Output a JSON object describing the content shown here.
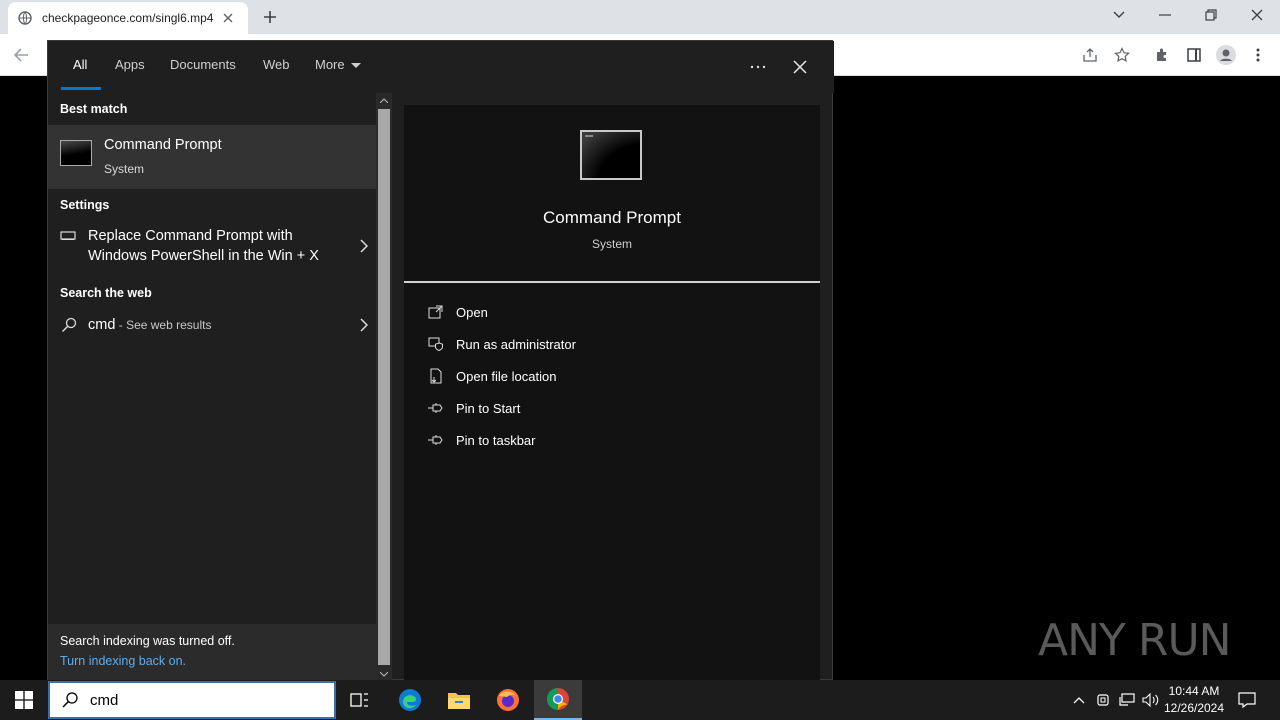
{
  "browser": {
    "tab_title": "checkpageonce.com/singl6.mp4",
    "controls": {
      "minimize": "minimize",
      "restore": "restore",
      "close": "close"
    }
  },
  "search_panel": {
    "tabs": [
      {
        "label": "All",
        "active": true
      },
      {
        "label": "Apps"
      },
      {
        "label": "Documents"
      },
      {
        "label": "Web"
      },
      {
        "label": "More"
      }
    ],
    "sections": {
      "best_match": "Best match",
      "settings": "Settings",
      "search_web": "Search the web"
    },
    "best_match_item": {
      "title": "Command Prompt",
      "subtitle": "System"
    },
    "settings_item": {
      "line1": "Replace Command Prompt with",
      "line2": "Windows PowerShell in the Win + X"
    },
    "web_item": {
      "query": "cmd",
      "suffix": " - See web results"
    },
    "footer": {
      "text": "Search indexing was turned off.",
      "link": "Turn indexing back on."
    },
    "detail": {
      "title": "Command Prompt",
      "subtitle": "System",
      "actions": [
        {
          "label": "Open",
          "icon": "open-icon"
        },
        {
          "label": "Run as administrator",
          "icon": "shield-icon"
        },
        {
          "label": "Open file location",
          "icon": "file-location-icon"
        },
        {
          "label": "Pin to Start",
          "icon": "pin-icon"
        },
        {
          "label": "Pin to taskbar",
          "icon": "pin-icon"
        }
      ]
    }
  },
  "taskbar": {
    "search_value": "cmd",
    "clock_time": "10:44 AM",
    "clock_date": "12/26/2024",
    "apps": [
      "task-view",
      "edge",
      "file-explorer",
      "firefox",
      "chrome"
    ]
  },
  "watermark": {
    "text": "ANY RUN"
  },
  "colors": {
    "accent": "#0078d4",
    "link": "#5aaef0",
    "panel_bg": "#1f1f1f",
    "detail_bg": "#121212"
  }
}
